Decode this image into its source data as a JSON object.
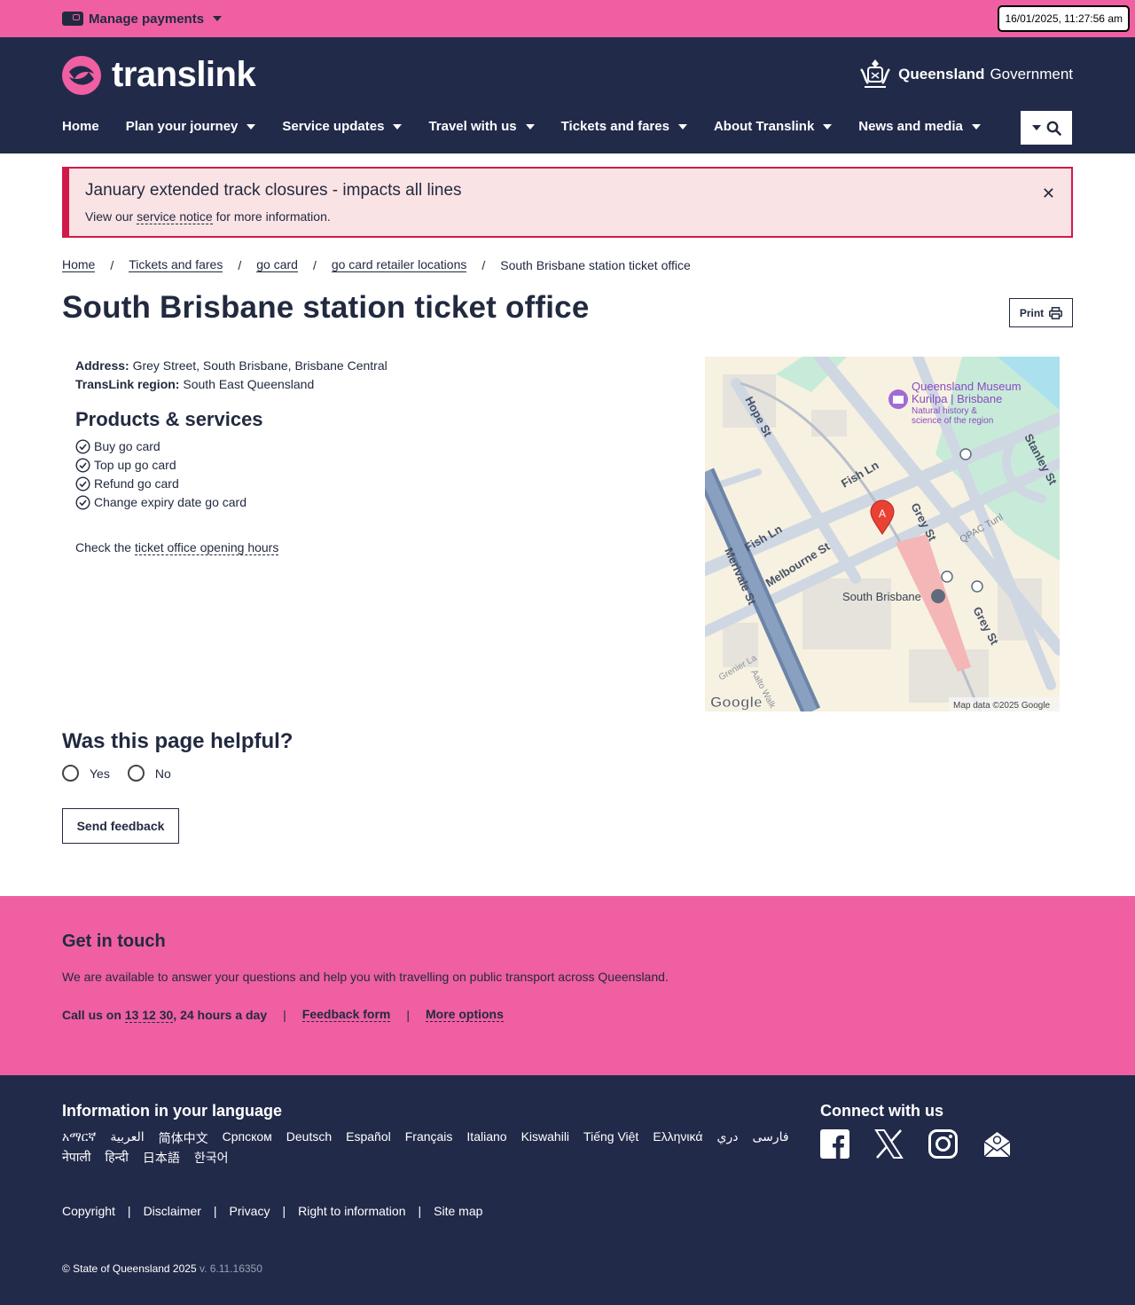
{
  "topbar": {
    "manage_label": "Manage payments",
    "clock": "16/01/2025, 11:27:56 am"
  },
  "header": {
    "brand": "translink",
    "gov_bold": "Queensland",
    "gov_rest": "Government",
    "nav": [
      {
        "label": "Home"
      },
      {
        "label": "Plan your journey"
      },
      {
        "label": "Service updates"
      },
      {
        "label": "Travel with us"
      },
      {
        "label": "Tickets and fares"
      },
      {
        "label": "About Translink"
      },
      {
        "label": "News and media"
      }
    ]
  },
  "alert": {
    "title": "January extended track closures - impacts all lines",
    "text_before": "View our ",
    "link": "service notice",
    "text_after": " for more information."
  },
  "breadcrumb": {
    "items": [
      "Home",
      "Tickets and fares",
      "go card",
      "go card retailer locations"
    ],
    "current": "South Brisbane station ticket office",
    "separator": "/"
  },
  "page": {
    "title": "South Brisbane station ticket office",
    "print_label": "Print",
    "address_label": "Address:",
    "address": "Grey Street, South Brisbane, Brisbane Central",
    "region_label": "TransLink region:",
    "region": "South East Queensland",
    "services_heading": "Products & services",
    "services": [
      "Buy go card",
      "Top up go card",
      "Refund go card",
      "Change expiry date go card"
    ],
    "hours_before": "Check the ",
    "hours_link": "ticket office opening hours"
  },
  "map": {
    "labels": {
      "museum1": "Queensland Museum",
      "museum2": "Kurilpa | Brisbane",
      "museum3": "Natural history &",
      "museum4": "science of the region",
      "hope": "Hope St",
      "stanley": "Stanley St",
      "fish1": "Fish Ln",
      "fish2": "Fish Ln",
      "grey1": "Grey St",
      "grey2": "Grey St",
      "qpac": "QPAC Tunl",
      "melbourne": "Melbourne St",
      "merivale": "Merivale St",
      "station": "South Brisbane",
      "grenier": "Grenier La",
      "aalto": "Aalto Walk",
      "marker": "A",
      "google": "Google",
      "credit": "Map data ©2025 Google"
    }
  },
  "feedback": {
    "heading": "Was this page helpful?",
    "yes": "Yes",
    "no": "No",
    "send": "Send feedback"
  },
  "touch": {
    "heading": "Get in touch",
    "text": "We are available to answer your questions and help you with travelling on public transport across Queensland.",
    "call_before": "Call us on ",
    "call_number": "13 12 30",
    "call_after": ", 24 hours a day",
    "feedback_link": "Feedback form",
    "more_link": "More options",
    "separator": "|"
  },
  "footer": {
    "lang_heading": "Information in your language",
    "languages": [
      "አማርኛ",
      "العربية",
      "简体中文",
      "Српском",
      "Deutsch",
      "Español",
      "Français",
      "Italiano",
      "Kiswahili",
      "Tiếng Việt",
      "Ελληνικά",
      "دري",
      "فارسی",
      "नेपाली",
      "हिन्दी",
      "日本語",
      "한국어"
    ],
    "connect_heading": "Connect with us",
    "legal": [
      "Copyright",
      "Disclaimer",
      "Privacy",
      "Right to information",
      "Site map"
    ],
    "separator": "|",
    "copyright": "© State of Queensland 2025",
    "version": " v. 6.11.16350"
  },
  "colors": {
    "pink": "#ef5fa2",
    "navy": "#222a4a",
    "alert_red": "#d1194a",
    "alert_bg": "#fae3e4"
  }
}
